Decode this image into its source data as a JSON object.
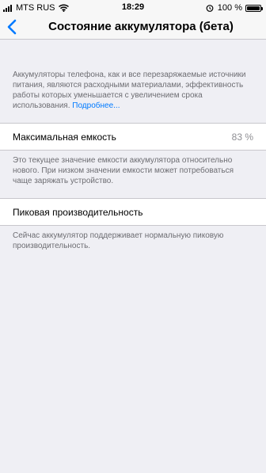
{
  "status_bar": {
    "carrier": "MTS RUS",
    "time": "18:29",
    "battery_percent": "100 %",
    "signal_bars": 4,
    "icons": [
      "signal-bars-icon",
      "wifi-icon",
      "alarm-icon",
      "battery-icon"
    ]
  },
  "nav": {
    "back_icon": "chevron-left-icon",
    "title": "Состояние аккумулятора (бета)",
    "accent_color": "#007aff"
  },
  "intro": {
    "text": "Аккумуляторы телефона, как и все перезаряжаемые источники питания, являются расходными материалами, эффективность работы которых уменьшается с увеличением срока использования.",
    "link": "Подробнее..."
  },
  "max_capacity": {
    "label": "Максимальная емкость",
    "value": "83 %",
    "footer": "Это текущее значение емкости аккумулятора относительно нового. При низком значении емкости может потребоваться чаще заряжать устройство."
  },
  "peak_performance": {
    "label": "Пиковая производительность",
    "footer": "Сейчас аккумулятор поддерживает нормальную пиковую производительность."
  }
}
